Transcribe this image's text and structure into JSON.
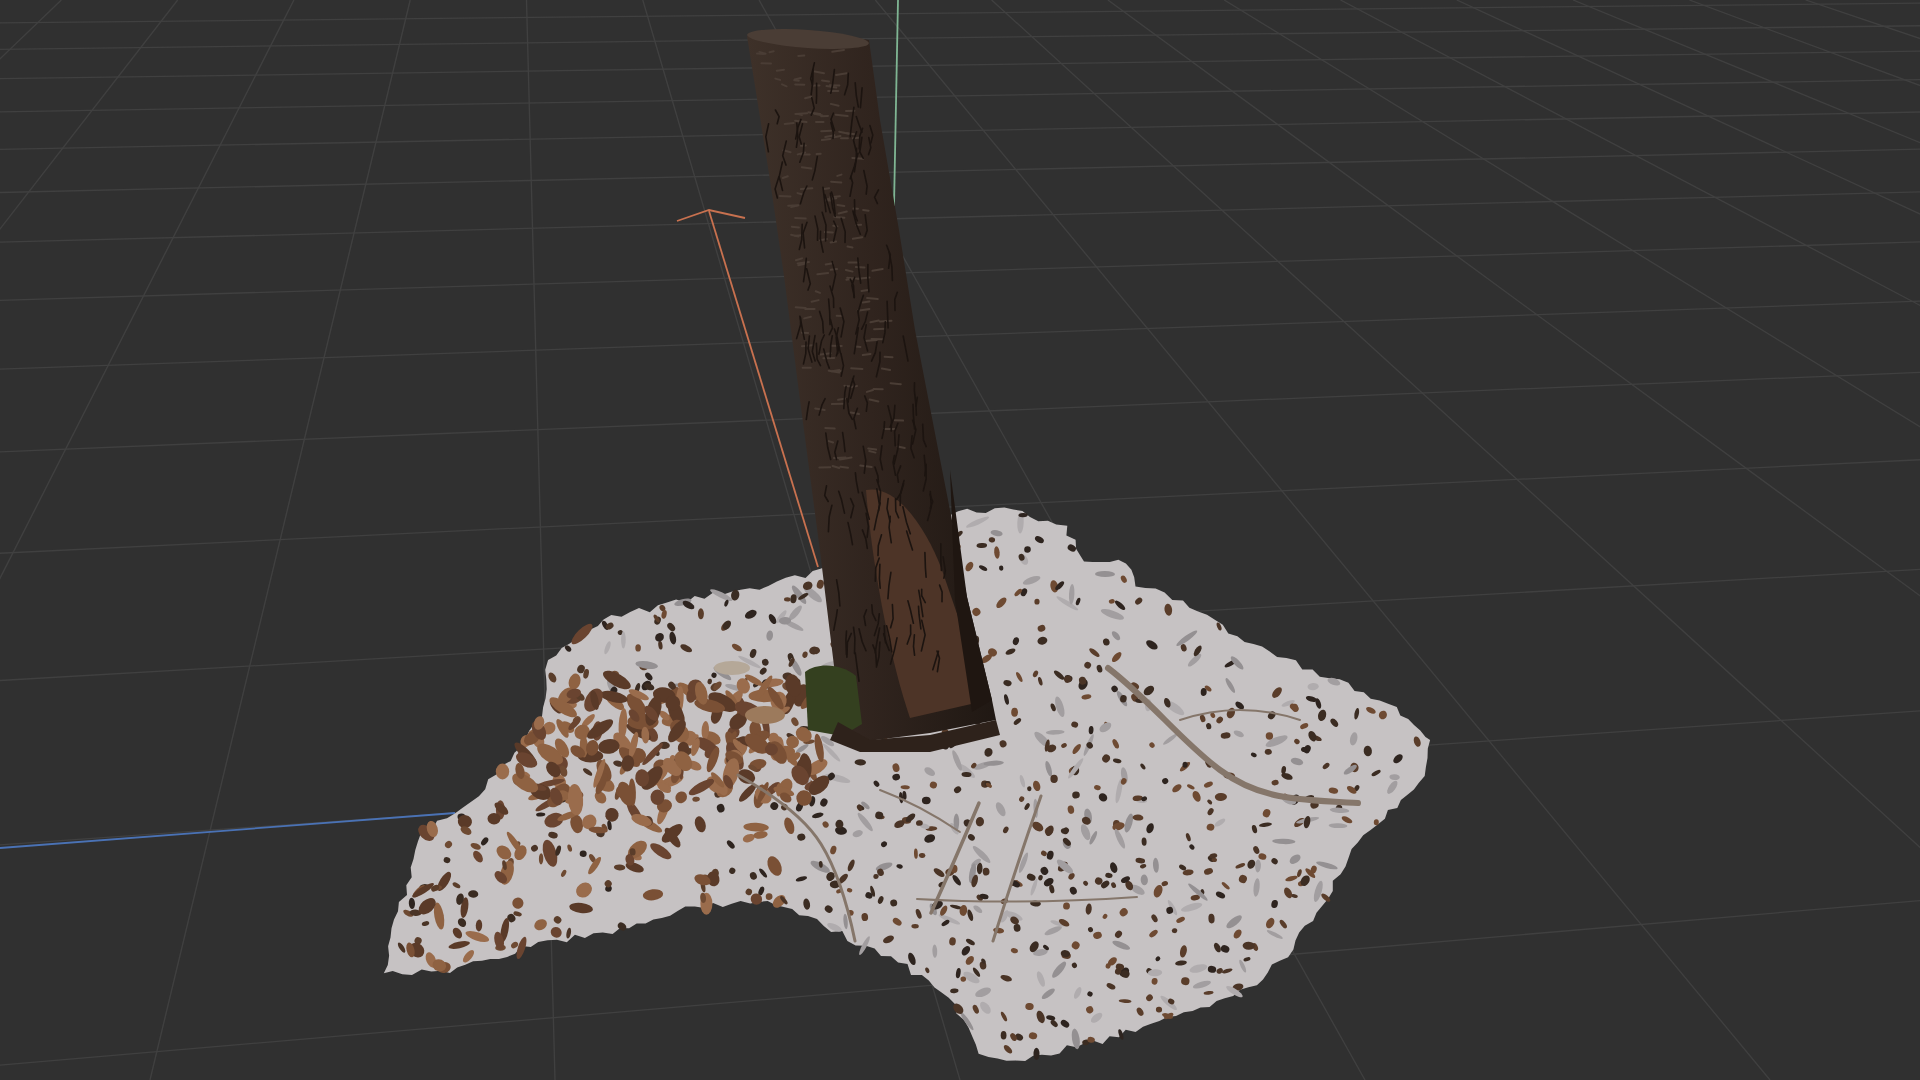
{
  "viewport": {
    "axis_lines": [
      {
        "kind": "arrow",
        "color": "#c8714f"
      },
      {
        "kind": "line",
        "color": "#7fb593"
      },
      {
        "kind": "line",
        "color": "#4a72b5"
      }
    ]
  }
}
